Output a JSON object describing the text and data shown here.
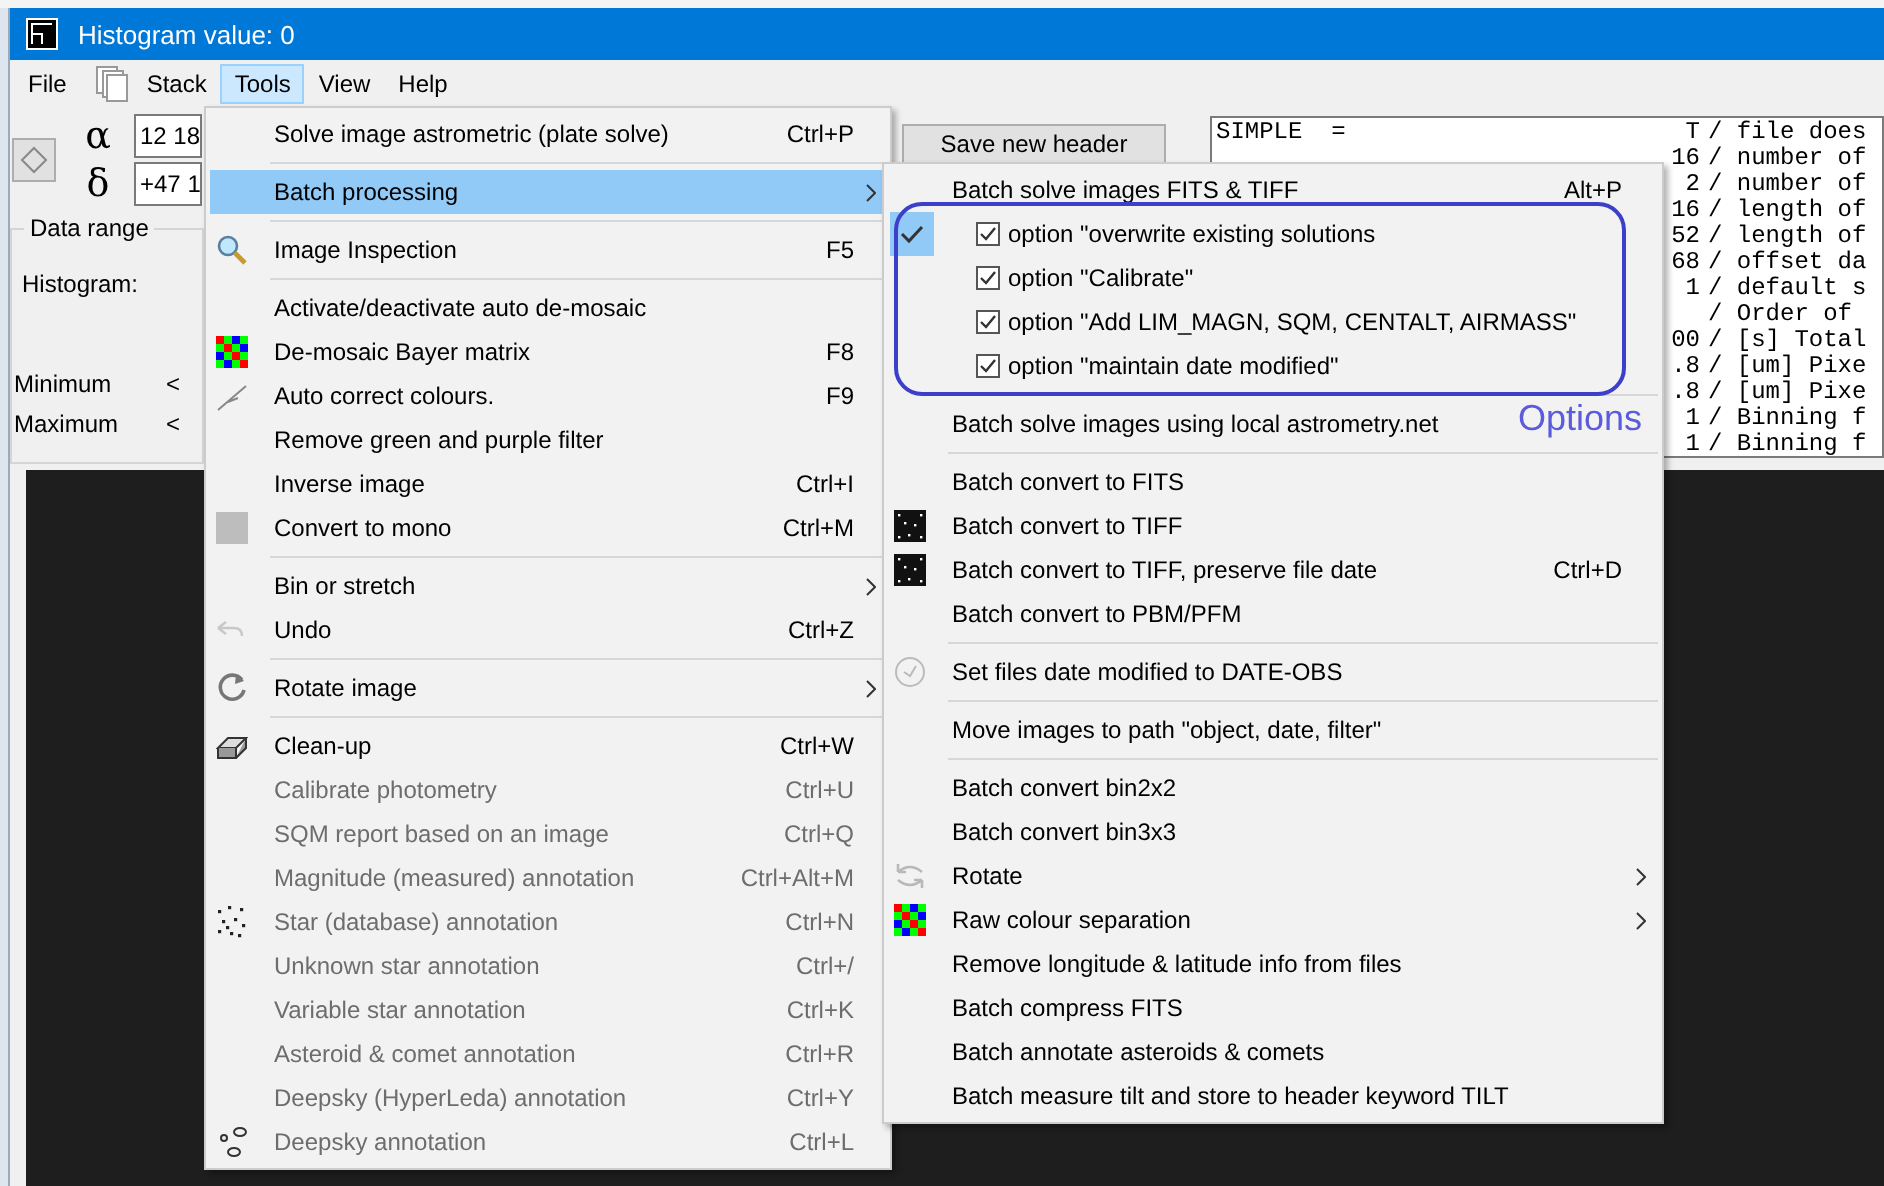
{
  "window": {
    "title": "Histogram value: 0"
  },
  "menubar": [
    {
      "label": "File",
      "selected": false
    },
    {
      "label": "Stack",
      "selected": false
    },
    {
      "label": "Tools",
      "selected": true
    },
    {
      "label": "View",
      "selected": false
    },
    {
      "label": "Help",
      "selected": false
    }
  ],
  "coordinates": [
    {
      "symbol": "α",
      "value": "12 18"
    },
    {
      "symbol": "δ",
      "value": "+47 1"
    }
  ],
  "data_range": {
    "title": "Data range",
    "histogram_label": "Histogram:",
    "rows": [
      {
        "label": "Minimum",
        "button": "<"
      },
      {
        "label": "Maximum",
        "button": "<"
      }
    ]
  },
  "save_header_button": "Save new header",
  "header_lines": [
    {
      "keyword": "SIMPLE  =",
      "value": "T",
      "comment": "/ file does"
    },
    {
      "value": "16",
      "comment": "/ number of"
    },
    {
      "value": "2",
      "comment": "/ number of"
    },
    {
      "value": "16",
      "comment": "/ length of"
    },
    {
      "value": "52",
      "comment": "/ length of"
    },
    {
      "value": "68",
      "comment": "/ offset da"
    },
    {
      "value": "1",
      "comment": "/ default s"
    },
    {
      "comment": "/ Order of"
    },
    {
      "value": "00",
      "comment": "/ [s] Total"
    },
    {
      "value": ".8",
      "comment": "/ [um] Pixe"
    },
    {
      "value": ".8",
      "comment": "/ [um] Pixe"
    },
    {
      "value": "1",
      "comment": "/ Binning f"
    },
    {
      "value": "1",
      "comment": "/ Binning f"
    }
  ],
  "tools_menu": [
    {
      "kind": "item",
      "label": "Solve image astrometric (plate solve)",
      "shortcut": "Ctrl+P",
      "submenu": false,
      "disabled": false,
      "selected": false
    },
    {
      "kind": "separator"
    },
    {
      "kind": "item",
      "label": "Batch processing",
      "submenu": true,
      "disabled": false,
      "selected": true
    },
    {
      "kind": "separator"
    },
    {
      "kind": "item",
      "label": "Image Inspection",
      "shortcut": "F5",
      "submenu": false,
      "disabled": false,
      "selected": false
    },
    {
      "kind": "separator"
    },
    {
      "kind": "item",
      "label": "Activate/deactivate auto de-mosaic",
      "submenu": false,
      "disabled": false,
      "selected": false
    },
    {
      "kind": "item",
      "label": "De-mosaic Bayer matrix",
      "shortcut": "F8",
      "submenu": false,
      "disabled": false,
      "selected": false
    },
    {
      "kind": "item",
      "label": "Auto correct colours.",
      "shortcut": "F9",
      "submenu": false,
      "disabled": false,
      "selected": false
    },
    {
      "kind": "item",
      "label": "Remove green and purple filter",
      "submenu": false,
      "disabled": false,
      "selected": false
    },
    {
      "kind": "item",
      "label": "Inverse image",
      "shortcut": "Ctrl+I",
      "submenu": false,
      "disabled": false,
      "selected": false
    },
    {
      "kind": "item",
      "label": "Convert to mono",
      "shortcut": "Ctrl+M",
      "submenu": false,
      "disabled": false,
      "selected": false
    },
    {
      "kind": "separator"
    },
    {
      "kind": "item",
      "label": "Bin or stretch",
      "submenu": true,
      "disabled": false,
      "selected": false
    },
    {
      "kind": "item",
      "label": "Undo",
      "shortcut": "Ctrl+Z",
      "submenu": false,
      "disabled": false,
      "selected": false
    },
    {
      "kind": "separator"
    },
    {
      "kind": "item",
      "label": "Rotate image",
      "submenu": true,
      "disabled": false,
      "selected": false
    },
    {
      "kind": "separator"
    },
    {
      "kind": "item",
      "label": "Clean-up",
      "shortcut": "Ctrl+W",
      "submenu": false,
      "disabled": false,
      "selected": false
    },
    {
      "kind": "item",
      "label": "Calibrate photometry",
      "shortcut": "Ctrl+U",
      "submenu": false,
      "disabled": true,
      "selected": false
    },
    {
      "kind": "item",
      "label": "SQM report based on an image",
      "shortcut": "Ctrl+Q",
      "submenu": false,
      "disabled": true,
      "selected": false
    },
    {
      "kind": "item",
      "label": "Magnitude (measured) annotation",
      "shortcut": "Ctrl+Alt+M",
      "submenu": false,
      "disabled": true,
      "selected": false
    },
    {
      "kind": "item",
      "label": "Star (database) annotation",
      "shortcut": "Ctrl+N",
      "submenu": false,
      "disabled": true,
      "selected": false
    },
    {
      "kind": "item",
      "label": "Unknown star annotation",
      "shortcut": "Ctrl+/",
      "submenu": false,
      "disabled": true,
      "selected": false
    },
    {
      "kind": "item",
      "label": "Variable star annotation",
      "shortcut": "Ctrl+K",
      "submenu": false,
      "disabled": true,
      "selected": false
    },
    {
      "kind": "item",
      "label": "Asteroid & comet annotation",
      "shortcut": "Ctrl+R",
      "submenu": false,
      "disabled": true,
      "selected": false
    },
    {
      "kind": "item",
      "label": "Deepsky (HyperLeda) annotation",
      "shortcut": "Ctrl+Y",
      "submenu": false,
      "disabled": true,
      "selected": false
    },
    {
      "kind": "item",
      "label": "Deepsky annotation",
      "shortcut": "Ctrl+L",
      "submenu": false,
      "disabled": true,
      "selected": false
    }
  ],
  "batch_submenu": [
    {
      "kind": "item",
      "label": "Batch solve images FITS & TIFF",
      "shortcut": "Alt+P",
      "submenu": false
    },
    {
      "kind": "option",
      "label": "option \"overwrite existing solutions",
      "checked": true,
      "box_checked": true
    },
    {
      "kind": "option",
      "label": "option \"Calibrate\"",
      "checked": false,
      "box_checked": true
    },
    {
      "kind": "option",
      "label": "option \"Add LIM_MAGN, SQM, CENTALT, AIRMASS\"",
      "checked": false,
      "box_checked": true
    },
    {
      "kind": "option",
      "label": "option \"maintain date modified\"",
      "checked": false,
      "box_checked": true
    },
    {
      "kind": "separator"
    },
    {
      "kind": "item",
      "label": "Batch solve images using local astrometry.net",
      "submenu": false
    },
    {
      "kind": "separator"
    },
    {
      "kind": "item",
      "label": "Batch convert to FITS",
      "submenu": false
    },
    {
      "kind": "item",
      "label": "Batch convert to TIFF",
      "submenu": false
    },
    {
      "kind": "item",
      "label": "Batch convert to TIFF, preserve file date",
      "shortcut": "Ctrl+D",
      "submenu": false
    },
    {
      "kind": "item",
      "label": "Batch convert to PBM/PFM",
      "submenu": false
    },
    {
      "kind": "separator"
    },
    {
      "kind": "item",
      "label": "Set files date modified to DATE-OBS",
      "submenu": false
    },
    {
      "kind": "separator"
    },
    {
      "kind": "item",
      "label": "Move images to path \"object, date, filter\"",
      "submenu": false
    },
    {
      "kind": "separator"
    },
    {
      "kind": "item",
      "label": "Batch convert bin2x2",
      "submenu": false
    },
    {
      "kind": "item",
      "label": "Batch convert bin3x3",
      "submenu": false
    },
    {
      "kind": "item",
      "label": "Rotate",
      "submenu": true
    },
    {
      "kind": "item",
      "label": "Raw colour separation",
      "submenu": true
    },
    {
      "kind": "item",
      "label": "Remove longitude & latitude info from files",
      "submenu": false
    },
    {
      "kind": "item",
      "label": "Batch compress FITS",
      "submenu": false
    },
    {
      "kind": "item",
      "label": "Batch annotate asteroids & comets",
      "submenu": false
    },
    {
      "kind": "item",
      "label": "Batch measure tilt and store to header keyword TILT",
      "submenu": false
    }
  ],
  "annotation": {
    "label": "Options"
  }
}
